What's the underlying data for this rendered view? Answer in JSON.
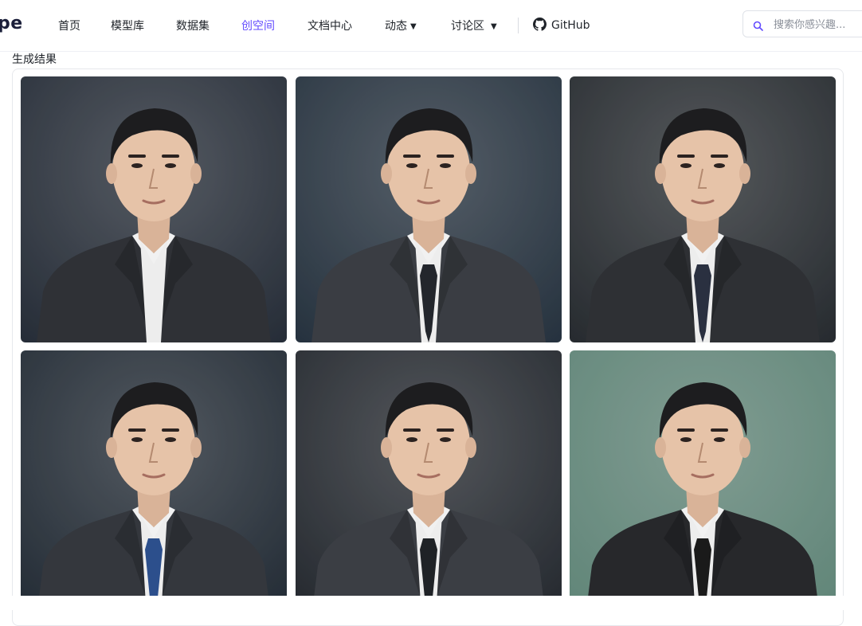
{
  "logo": "pe",
  "nav": {
    "items": [
      {
        "label": "首页"
      },
      {
        "label": "模型库"
      },
      {
        "label": "数据集"
      },
      {
        "label": "创空间"
      },
      {
        "label": "文档中心"
      },
      {
        "label": "动态"
      },
      {
        "label": "讨论区"
      }
    ],
    "active": "创空间",
    "github": "GitHub"
  },
  "search": {
    "placeholder": "搜索你感兴趣..."
  },
  "results": {
    "title": "生成结果",
    "images": [
      {
        "bg": "#2c3440",
        "tie": "none",
        "suit": "#2f3136"
      },
      {
        "bg": "#2c3a48",
        "tie": "#23262c",
        "suit": "#3a3d43"
      },
      {
        "bg": "#2d3237",
        "tie": "#2a3040",
        "suit": "#2e3034"
      },
      {
        "bg": "#28323d",
        "tie": "#2c4f8c",
        "suit": "#34373d"
      },
      {
        "bg": "#2a2f36",
        "tie": "#1f2226",
        "suit": "#3b3e44"
      },
      {
        "bg": "#6e9889",
        "tie": "#1a1a1a",
        "suit": "#27282b"
      }
    ]
  },
  "colors": {
    "accent": "#624aff",
    "text": "#1f2329",
    "border": "#e6e8ec"
  }
}
